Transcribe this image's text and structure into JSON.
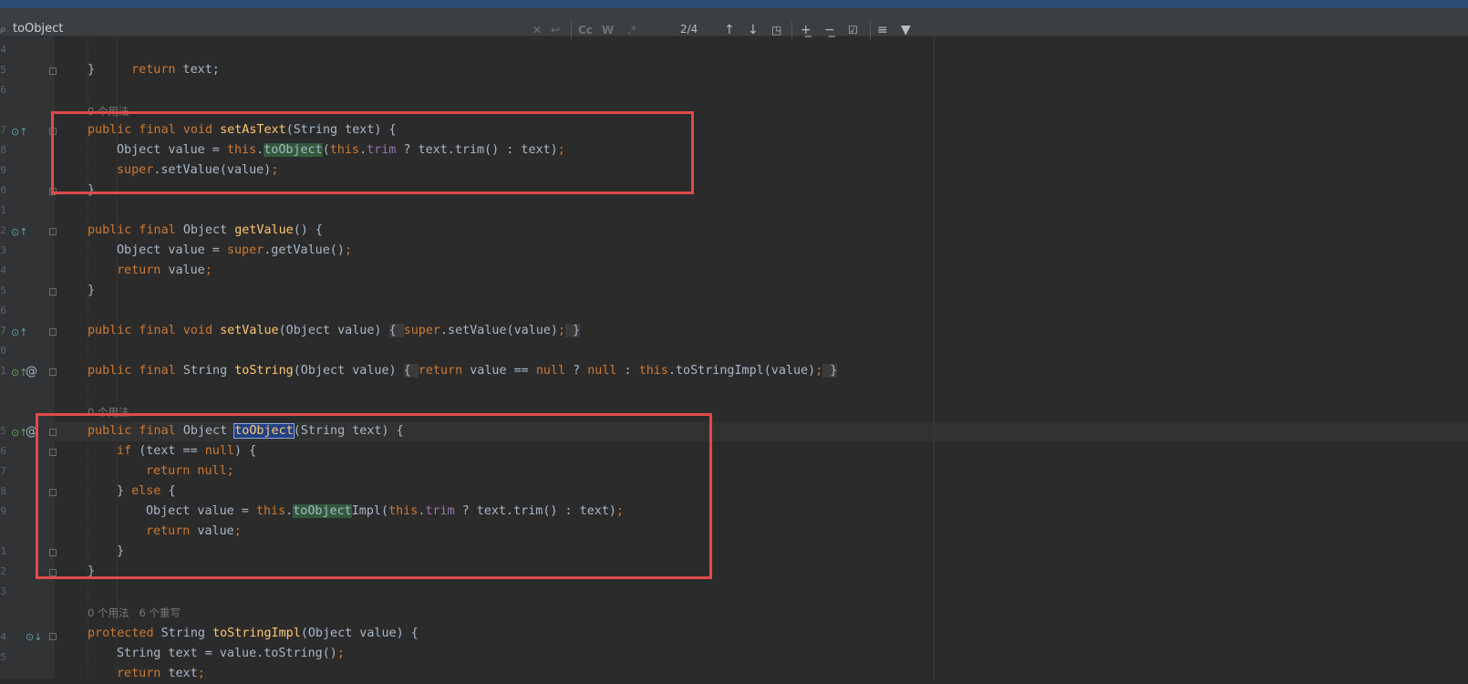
{
  "find_bar": {
    "query": "toObject",
    "match_count": "2/4",
    "case_button": "Cc",
    "word_button": "W",
    "regex_button": ".*",
    "icons": [
      "search-icon",
      "clear-icon",
      "replace-history-icon",
      "match-case-icon",
      "whole-word-icon",
      "regex-icon",
      "previous-occurrence-icon",
      "next-occurrence-icon",
      "open-in-window-icon",
      "add-selection-icon",
      "remove-selection-icon",
      "select-all-occurrences-icon",
      "filter-search-icon",
      "filter-icon"
    ]
  },
  "editor": {
    "line_numbers": [
      "4",
      "5",
      "6",
      "7",
      "8",
      "9",
      "0",
      "1",
      "2",
      "3",
      "4",
      "5",
      "6",
      "7",
      "0",
      "1",
      "5",
      "6",
      "7",
      "8",
      "9",
      "1",
      "2",
      "3",
      "4",
      "5"
    ],
    "inlay_hints": {
      "set_as_text_usages": "0 个用法",
      "to_object_usages": "0 个用法",
      "to_string_impl_usages": "0 个用法",
      "to_string_impl_overrides": "6 个重写"
    },
    "lines": {
      "l1": "return text;",
      "l2": "}",
      "set_as_text_sig": "public final void setAsText(String text) {",
      "set_as_text_body1": "Object value = this.toObject(this.trim ? text.trim() : text);",
      "set_as_text_body2": "super.setValue(value);",
      "set_as_text_close": "}",
      "get_value_sig": "public final Object getValue() {",
      "get_value_body1": "Object value = super.getValue();",
      "get_value_body2": "return value;",
      "get_value_close": "}",
      "set_value": "public final void setValue(Object value) { super.setValue(value); }",
      "to_string": "public final String toString(Object value) { return value == null ? null : this.toStringImpl(value); }",
      "to_object_sig": "public final Object toObject(String text) {",
      "to_object_if": "if (text == null) {",
      "to_object_return_null": "return null;",
      "to_object_else": "} else {",
      "to_object_value": "Object value = this.toObjectImpl(this.trim ? text.trim() : text);",
      "to_object_return": "return value;",
      "to_object_inner_close": "}",
      "to_object_close": "}",
      "to_string_impl_sig": "protected String toStringImpl(Object value) {",
      "to_string_impl_body1": "String text = value.toString();",
      "to_string_impl_body2": "return text;"
    }
  },
  "colors": {
    "background": "#2b2b2b",
    "keyword": "#cc7832",
    "method": "#ffc66d",
    "field": "#9876aa",
    "text": "#a9b7c6",
    "highlight": "#32593d",
    "selection": "#214283",
    "annotation_box": "#e04a4a"
  }
}
